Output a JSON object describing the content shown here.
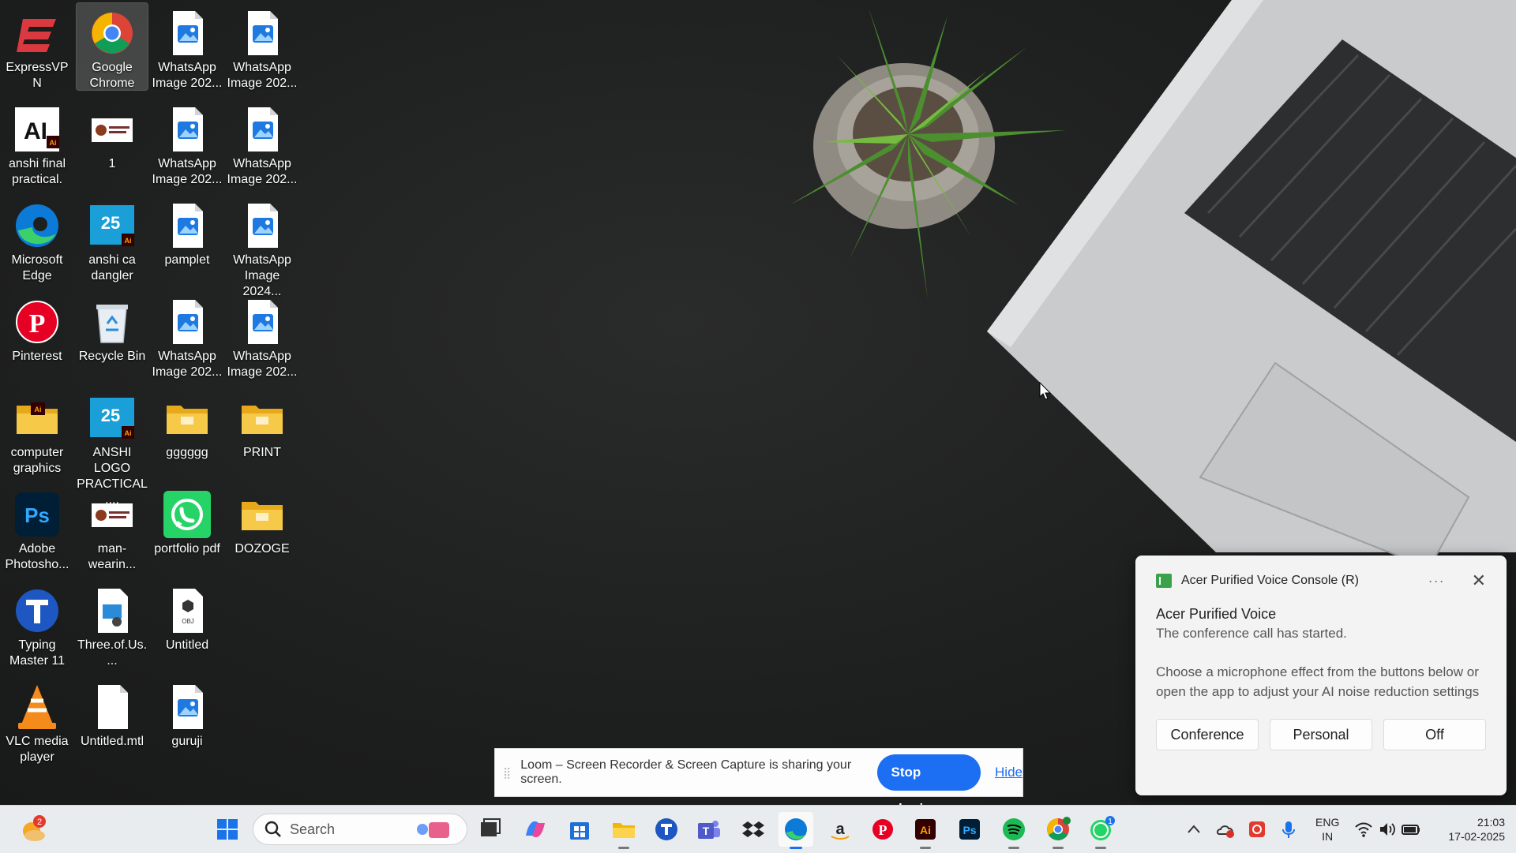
{
  "desktop": {
    "icons": [
      {
        "label": "ExpressVPN",
        "icon": "expressvpn-icon"
      },
      {
        "label": "Google Chrome",
        "icon": "chrome-icon",
        "selected": true
      },
      {
        "label": "WhatsApp Image 202...",
        "icon": "image-file-icon"
      },
      {
        "label": "WhatsApp Image 202...",
        "icon": "image-file-icon"
      },
      {
        "label": "anshi final practical.",
        "icon": "illustrator-file-icon"
      },
      {
        "label": "1",
        "icon": "image-thumbnail-icon"
      },
      {
        "label": "WhatsApp Image 202...",
        "icon": "image-file-icon"
      },
      {
        "label": "WhatsApp Image 202...",
        "icon": "image-file-icon"
      },
      {
        "label": "Microsoft Edge",
        "icon": "edge-icon"
      },
      {
        "label": "anshi ca dangler",
        "icon": "illustrator-thumbnail-icon"
      },
      {
        "label": "pamplet",
        "icon": "image-file-icon"
      },
      {
        "label": "WhatsApp Image 2024...",
        "icon": "image-file-icon"
      },
      {
        "label": "Pinterest",
        "icon": "pinterest-icon"
      },
      {
        "label": "Recycle Bin",
        "icon": "recycle-bin-icon"
      },
      {
        "label": "WhatsApp Image 202...",
        "icon": "image-file-icon"
      },
      {
        "label": "WhatsApp Image 202...",
        "icon": "image-file-icon"
      },
      {
        "label": "computer graphics",
        "icon": "folder-ai-icon"
      },
      {
        "label": "ANSHI LOGO PRACTICAL....",
        "icon": "illustrator-thumbnail-icon"
      },
      {
        "label": "gggggg",
        "icon": "folder-icon"
      },
      {
        "label": "PRINT",
        "icon": "folder-icon"
      },
      {
        "label": "Adobe Photosho...",
        "icon": "photoshop-icon"
      },
      {
        "label": "man-wearin...",
        "icon": "image-thumbnail-icon"
      },
      {
        "label": "portfolio pdf",
        "icon": "whatsapp-icon"
      },
      {
        "label": "DOZOGE",
        "icon": "folder-icon"
      },
      {
        "label": "Typing Master 11",
        "icon": "typingmaster-icon"
      },
      {
        "label": "Three.of.Us....",
        "icon": "media-file-icon"
      },
      {
        "label": "Untitled",
        "icon": "obj-file-icon"
      },
      {
        "label": "",
        "icon": ""
      },
      {
        "label": "VLC media player",
        "icon": "vlc-icon"
      },
      {
        "label": "Untitled.mtl",
        "icon": "blank-file-icon"
      },
      {
        "label": "guruji",
        "icon": "image-file-icon"
      }
    ]
  },
  "notification": {
    "app_name": "Acer Purified Voice Console (R)",
    "more": "···",
    "close": "✕",
    "title": "Acer Purified Voice",
    "subtitle": "The conference call has started.",
    "body": "Choose a microphone effect from the buttons below or open the app to adjust your AI noise reduction settings",
    "buttons": [
      "Conference",
      "Personal",
      "Off"
    ]
  },
  "loom": {
    "message": "Loom – Screen Recorder & Screen Capture is sharing your screen.",
    "stop_label": "Stop sharing",
    "hide_label": "Hide"
  },
  "taskbar": {
    "weather_badge": "2",
    "search_placeholder": "Search",
    "apps": [
      "start",
      "search",
      "task-view",
      "copilot",
      "microsoft-store",
      "file-explorer",
      "typingmaster",
      "teams",
      "dropbox",
      "edge",
      "amazon",
      "pinterest",
      "illustrator",
      "photoshop",
      "spotify",
      "chrome",
      "whatsapp"
    ],
    "chrome_badge": "",
    "whatsapp_badge": "1",
    "language": [
      "ENG",
      "IN"
    ],
    "time": "21:03",
    "date": "17-02-2025"
  },
  "colors": {
    "accent": "#1c6ef2",
    "taskbar": "#e9ecef",
    "wallpaper": "#1e1f1f"
  }
}
